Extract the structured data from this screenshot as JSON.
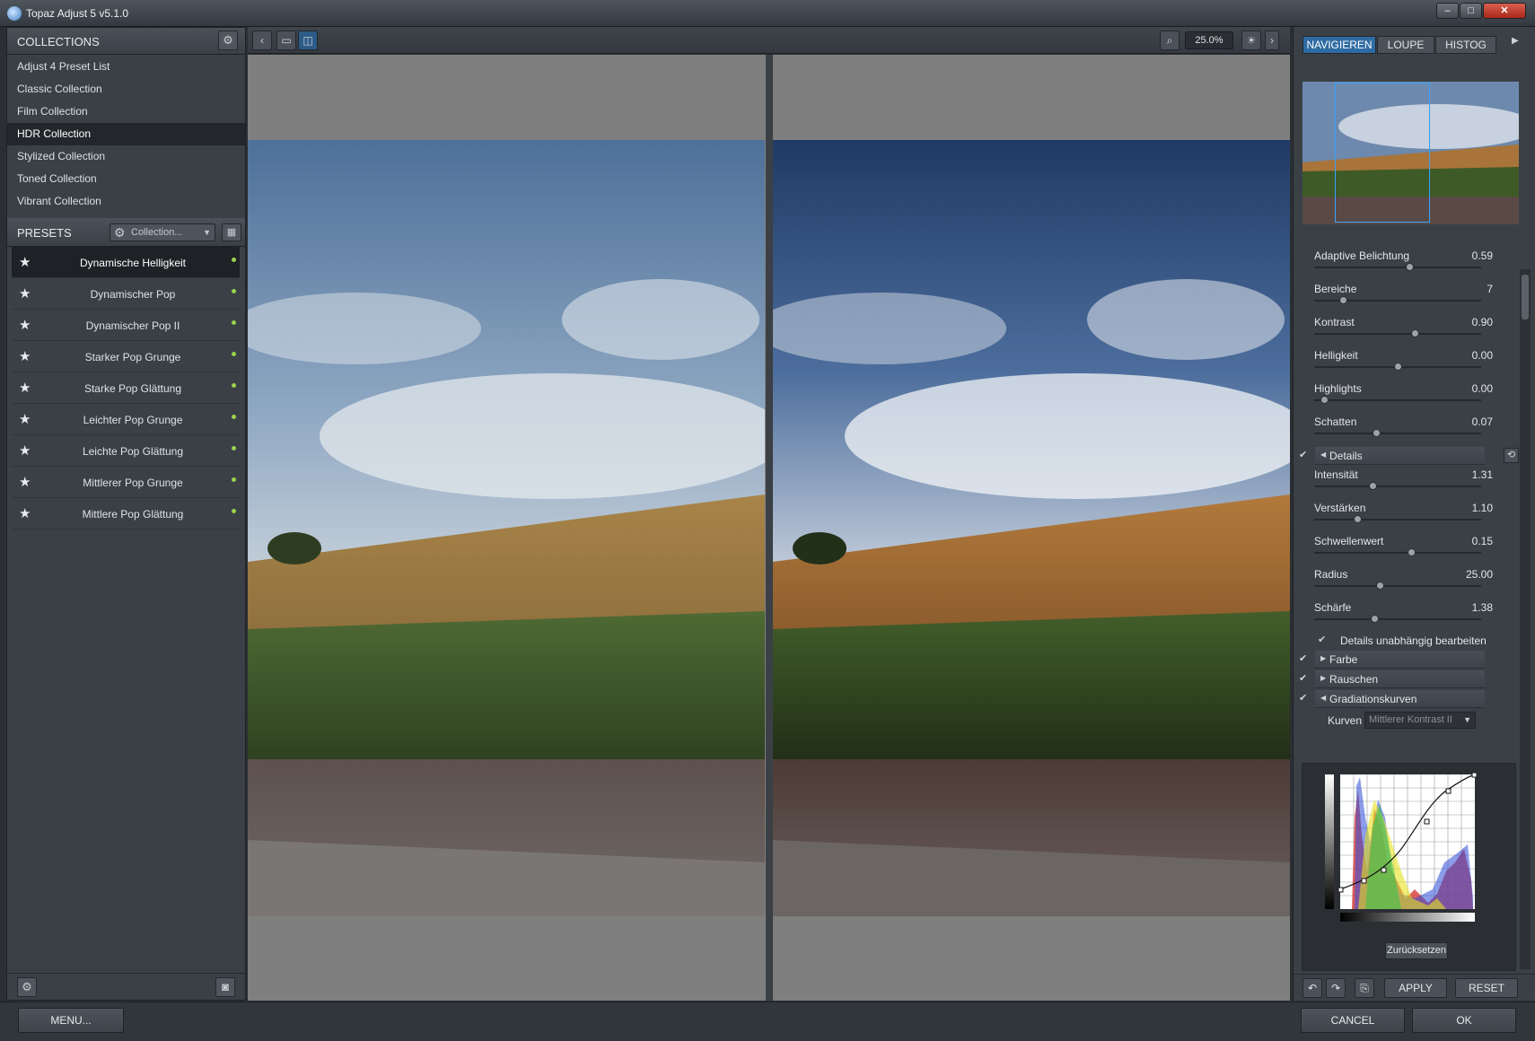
{
  "window": {
    "title": "Topaz Adjust 5 v5.1.0",
    "min_icon": "minimize-icon",
    "max_icon": "maximize-icon",
    "close_icon": "close-icon"
  },
  "collections": {
    "header": "COLLECTIONS",
    "items": [
      {
        "label": "Adjust 4 Preset List"
      },
      {
        "label": "Classic Collection"
      },
      {
        "label": "Film Collection"
      },
      {
        "label": "HDR Collection",
        "active": true
      },
      {
        "label": "Stylized Collection"
      },
      {
        "label": "Toned Collection"
      },
      {
        "label": "Vibrant Collection"
      }
    ]
  },
  "presets": {
    "header": "PRESETS",
    "filter_label": "Collection...",
    "items": [
      {
        "label": "Dynamische Helligkeit",
        "active": true
      },
      {
        "label": "Dynamischer Pop"
      },
      {
        "label": "Dynamischer Pop II"
      },
      {
        "label": "Starker Pop Grunge"
      },
      {
        "label": "Starke Pop Glättung"
      },
      {
        "label": "Leichter Pop Grunge"
      },
      {
        "label": "Leichte Pop Glättung"
      },
      {
        "label": "Mittlerer Pop Grunge"
      },
      {
        "label": "Mittlere Pop Glättung"
      }
    ]
  },
  "toolbar": {
    "zoom": "25.0%"
  },
  "right": {
    "tabs": [
      "NAVIGIEREN",
      "LOUPE",
      "HISTOG"
    ],
    "active_tab": "NAVIGIEREN",
    "main_sliders": [
      {
        "label": "Adaptive Belichtung",
        "value": "0.59",
        "pos": 0.57
      },
      {
        "label": "Bereiche",
        "value": "7",
        "pos": 0.17
      },
      {
        "label": "Kontrast",
        "value": "0.90",
        "pos": 0.6
      },
      {
        "label": "Helligkeit",
        "value": "0.00",
        "pos": 0.5
      },
      {
        "label": "Highlights",
        "value": "0.00",
        "pos": 0.06
      },
      {
        "label": "Schatten",
        "value": "0.07",
        "pos": 0.37
      }
    ],
    "details_section": "Details",
    "details_sliders": [
      {
        "label": "Intensität",
        "value": "1.31",
        "pos": 0.35
      },
      {
        "label": "Verstärken",
        "value": "1.10",
        "pos": 0.26
      },
      {
        "label": "Schwellenwert",
        "value": "0.15",
        "pos": 0.58
      },
      {
        "label": "Radius",
        "value": "25.00",
        "pos": 0.39
      },
      {
        "label": "Schärfe",
        "value": "1.38",
        "pos": 0.36
      }
    ],
    "independent_label": "Details unabhängig bearbeiten",
    "sections": [
      "Farbe",
      "Rauschen"
    ],
    "curves_section": "Gradiationskurven",
    "curves_label": "Kurven",
    "curves_preset": "Mittlerer Kontrast II",
    "reset_curve": "Zurücksetzen",
    "apply": "APPLY",
    "reset": "RESET"
  },
  "bottom": {
    "menu": "MENU...",
    "cancel": "CANCEL",
    "ok": "OK"
  },
  "colors": {
    "accent": "#2f6ba3",
    "panel": "#3a4046",
    "canvas_bg": "#7f7f7f"
  }
}
